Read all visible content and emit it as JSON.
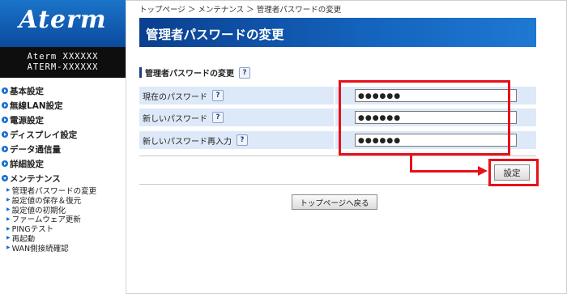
{
  "brand": {
    "logo_text": "Aterm",
    "model_line1": "Aterm XXXXXX",
    "model_line2": "ATERM-XXXXXX"
  },
  "sidebar": {
    "items": [
      {
        "label": "基本設定"
      },
      {
        "label": "無線LAN設定"
      },
      {
        "label": "電源設定"
      },
      {
        "label": "ディスプレイ設定"
      },
      {
        "label": "データ通信量"
      },
      {
        "label": "詳細設定"
      },
      {
        "label": "メンテナンス"
      }
    ],
    "subitems": [
      {
        "label": "管理者パスワードの変更"
      },
      {
        "label": "設定値の保存＆復元"
      },
      {
        "label": "設定値の初期化"
      },
      {
        "label": "ファームウェア更新"
      },
      {
        "label": "PINGテスト"
      },
      {
        "label": "再起動"
      },
      {
        "label": "WAN側接続確認"
      }
    ]
  },
  "breadcrumb": "トップページ ＞ メンテナンス ＞ 管理者パスワードの変更",
  "page_title": "管理者パスワードの変更",
  "section": {
    "title": "管理者パスワードの変更",
    "help": "?"
  },
  "form": {
    "rows": [
      {
        "label": "現在のパスワード",
        "help": "?",
        "value": "●●●●●●"
      },
      {
        "label": "新しいパスワード",
        "help": "?",
        "value": "●●●●●●"
      },
      {
        "label": "新しいパスワード再入力",
        "help": "?",
        "value": "●●●●●●"
      }
    ]
  },
  "buttons": {
    "set_label": "設定",
    "top_label": "トップページへ戻る"
  },
  "colors": {
    "highlight": "#e8101a",
    "title_bar": "#1465bf",
    "form_bg": "#dde9f8"
  }
}
